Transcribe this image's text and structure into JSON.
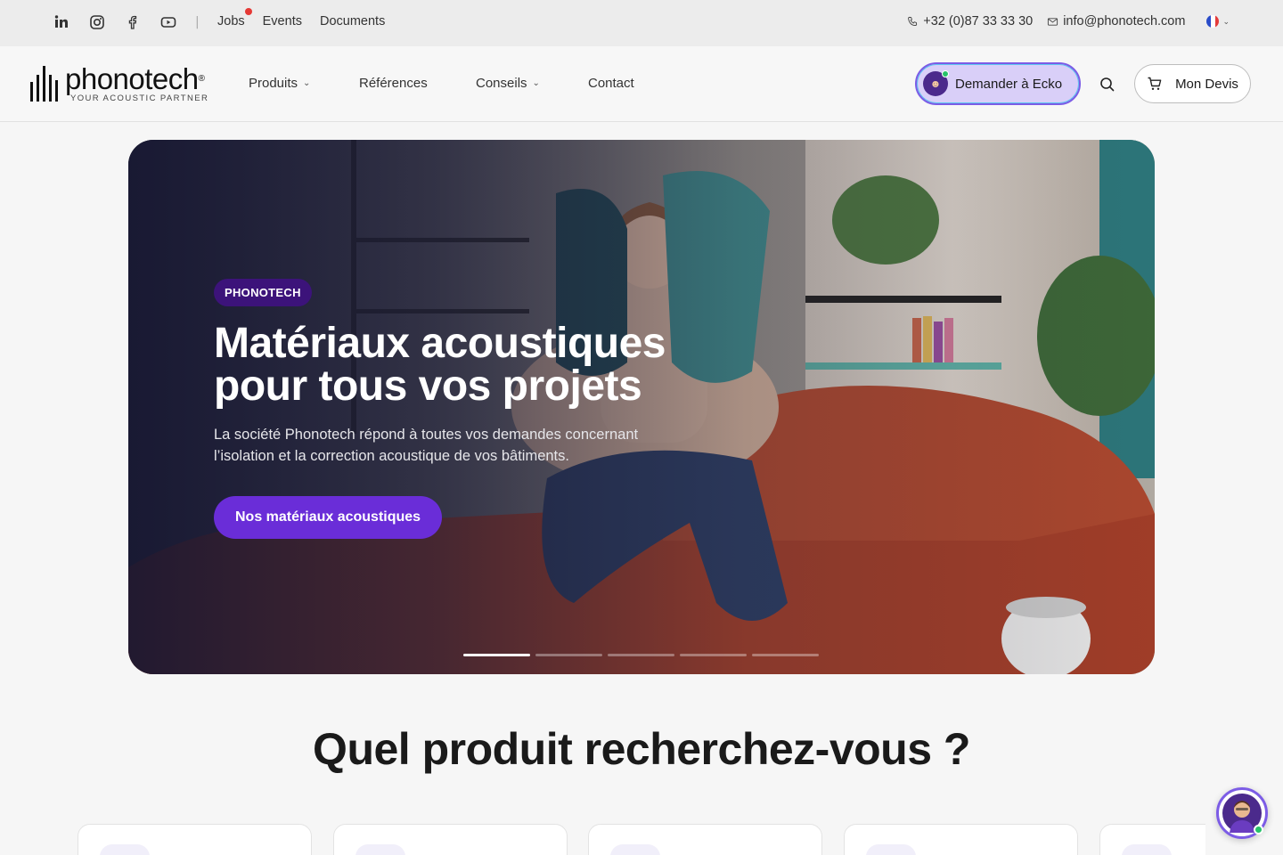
{
  "topbar": {
    "social_icons": [
      "linkedin-icon",
      "instagram-icon",
      "facebook-icon",
      "youtube-icon"
    ],
    "separator": "|",
    "links": [
      "Jobs",
      "Events",
      "Documents"
    ],
    "phone": "+32 (0)87 33 33 30",
    "email": "info@phonotech.com",
    "language_flag": "fr"
  },
  "header": {
    "logo_word": "phonotech",
    "logo_registered": "®",
    "logo_tagline": "YOUR ACOUSTIC PARTNER",
    "nav": [
      {
        "label": "Produits",
        "has_dropdown": true
      },
      {
        "label": "Références",
        "has_dropdown": false
      },
      {
        "label": "Conseils",
        "has_dropdown": true
      },
      {
        "label": "Contact",
        "has_dropdown": false
      }
    ],
    "ecko_label": "Demander à Ecko",
    "devis_label": "Mon Devis"
  },
  "hero": {
    "badge": "PHONOTECH",
    "title_line1": "Matériaux acoustiques",
    "title_line2": "pour tous vos projets",
    "description": "La société Phonotech répond à toutes vos demandes concernant l’isolation et la correction acoustique de vos bâtiments.",
    "cta": "Nos matériaux acoustiques",
    "slides_total": 5,
    "slide_active": 1
  },
  "section": {
    "title": "Quel produit recherchez-vous ?"
  },
  "colors": {
    "accent": "#6a2dd8",
    "badge": "#3c137a",
    "ecko_bg": "#d9cff8",
    "status_online": "#27c26a",
    "notification": "#e53935"
  }
}
